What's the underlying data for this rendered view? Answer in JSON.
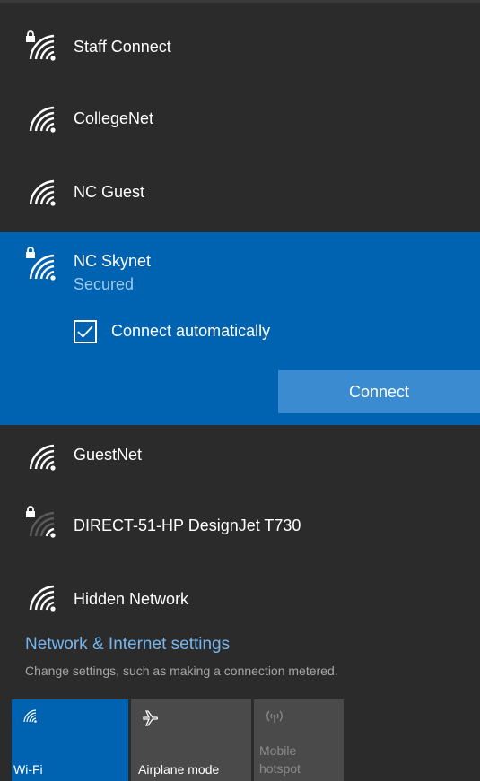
{
  "networks": [
    {
      "name": "Staff Connect",
      "secured": true,
      "icon": "wifi-lock-icon"
    },
    {
      "name": "CollegeNet",
      "secured": false,
      "icon": "wifi-icon"
    },
    {
      "name": "NC Guest",
      "secured": false,
      "icon": "wifi-icon"
    }
  ],
  "selected_network": {
    "name": "NC Skynet",
    "status": "Secured",
    "connect_automatically_label": "Connect automatically",
    "connect_automatically_checked": true,
    "connect_button_label": "Connect",
    "icon": "wifi-lock-icon"
  },
  "networks_after": [
    {
      "name": "GuestNet",
      "secured": false,
      "icon": "wifi-icon"
    },
    {
      "name": "DIRECT-51-HP DesignJet T730",
      "secured": true,
      "icon": "wifi-weak-lock-icon"
    },
    {
      "name": "Hidden Network",
      "secured": false,
      "icon": "wifi-icon"
    }
  ],
  "settings": {
    "link_label": "Network & Internet settings",
    "description": "Change settings, such as making a connection metered."
  },
  "quick_actions": {
    "wifi_label": "Wi-Fi",
    "airplane_label": "Airplane mode",
    "hotspot_label": "Mobile hotspot"
  },
  "colors": {
    "background": "#2b2b2b",
    "accent": "#0063b1",
    "connect_button": "#3b8bd1",
    "link": "#75b6f0",
    "tile_inactive": "#4a4a4a"
  }
}
